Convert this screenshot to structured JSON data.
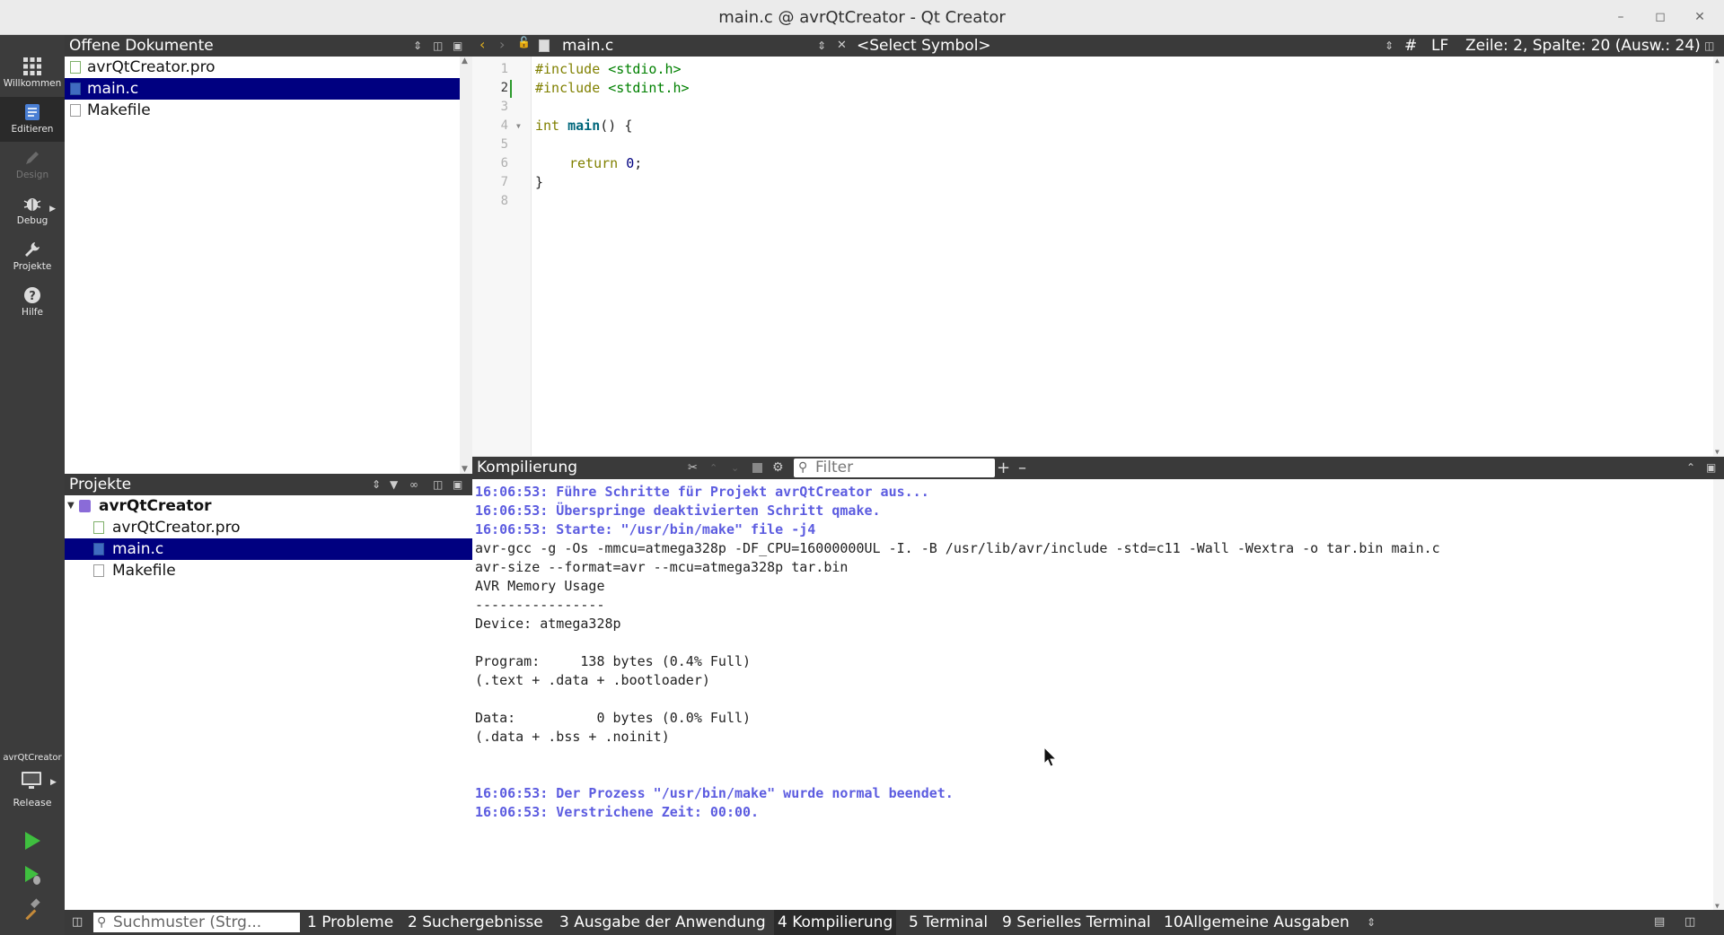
{
  "window": {
    "title": "main.c @ avrQtCreator - Qt Creator"
  },
  "modes": [
    {
      "label": "Willkommen"
    },
    {
      "label": "Editieren"
    },
    {
      "label": "Design"
    },
    {
      "label": "Debug"
    },
    {
      "label": "Projekte"
    },
    {
      "label": "Hilfe"
    }
  ],
  "kit": {
    "project": "avrQtCreator",
    "build": "Release"
  },
  "open_docs": {
    "title": "Offene Dokumente",
    "items": [
      {
        "label": "avrQtCreator.pro"
      },
      {
        "label": "main.c"
      },
      {
        "label": "Makefile"
      }
    ]
  },
  "projects": {
    "title": "Projekte",
    "root": "avrQtCreator",
    "items": [
      {
        "label": "avrQtCreator.pro"
      },
      {
        "label": "main.c"
      },
      {
        "label": "Makefile"
      }
    ]
  },
  "editor": {
    "file": "main.c",
    "symbol": "<Select Symbol>",
    "hash": "#",
    "line_ending": "LF",
    "cursor": "Zeile: 2, Spalte: 20 (Ausw.: 24)",
    "line_numbers": [
      "1",
      "2",
      "3",
      "4",
      "5",
      "6",
      "7",
      "8"
    ],
    "code": {
      "l1_kw": "#include",
      "l1_str": " <stdio.h>",
      "l2_kw": "#include",
      "l2_str": " <stdint.h>",
      "l4_type": "int",
      "l4_fn": " main",
      "l4_rest": "() {",
      "l6_kw": "return",
      "l6_num": " 0",
      "l6_rest": ";",
      "l7": "}"
    }
  },
  "output": {
    "title": "Kompilierung",
    "filter_placeholder": "Filter",
    "lines": [
      {
        "text": "16:06:53: Führe Schritte für Projekt avrQtCreator aus...",
        "kind": "info"
      },
      {
        "text": "16:06:53: Überspringe deaktivierten Schritt qmake.",
        "kind": "info"
      },
      {
        "text": "16:06:53: Starte: \"/usr/bin/make\" file -j4",
        "kind": "info"
      },
      {
        "text": "avr-gcc -g -Os -mmcu=atmega328p -DF_CPU=16000000UL -I. -B /usr/lib/avr/include -std=c11 -Wall -Wextra -o tar.bin main.c",
        "kind": "plain"
      },
      {
        "text": "avr-size --format=avr --mcu=atmega328p tar.bin",
        "kind": "plain"
      },
      {
        "text": "AVR Memory Usage",
        "kind": "plain"
      },
      {
        "text": "----------------",
        "kind": "plain"
      },
      {
        "text": "Device: atmega328p",
        "kind": "plain"
      },
      {
        "text": "",
        "kind": "plain"
      },
      {
        "text": "Program:     138 bytes (0.4% Full)",
        "kind": "plain"
      },
      {
        "text": "(.text + .data + .bootloader)",
        "kind": "plain"
      },
      {
        "text": "",
        "kind": "plain"
      },
      {
        "text": "Data:          0 bytes (0.0% Full)",
        "kind": "plain"
      },
      {
        "text": "(.data + .bss + .noinit)",
        "kind": "plain"
      },
      {
        "text": "",
        "kind": "plain"
      },
      {
        "text": "",
        "kind": "plain"
      },
      {
        "text": "16:06:53: Der Prozess \"/usr/bin/make\" wurde normal beendet.",
        "kind": "info"
      },
      {
        "text": "16:06:53: Verstrichene Zeit: 00:00.",
        "kind": "info"
      }
    ]
  },
  "bottom": {
    "search_placeholder": "Suchmuster (Strg...",
    "tabs": [
      {
        "label": "1 Probleme"
      },
      {
        "label": "2 Suchergebnisse"
      },
      {
        "label": "3 Ausgabe der Anwendung"
      },
      {
        "label": "4 Kompilierung"
      },
      {
        "label": "5 Terminal"
      },
      {
        "label": "9 Serielles Terminal"
      },
      {
        "label": "10Allgemeine Ausgaben"
      }
    ]
  }
}
